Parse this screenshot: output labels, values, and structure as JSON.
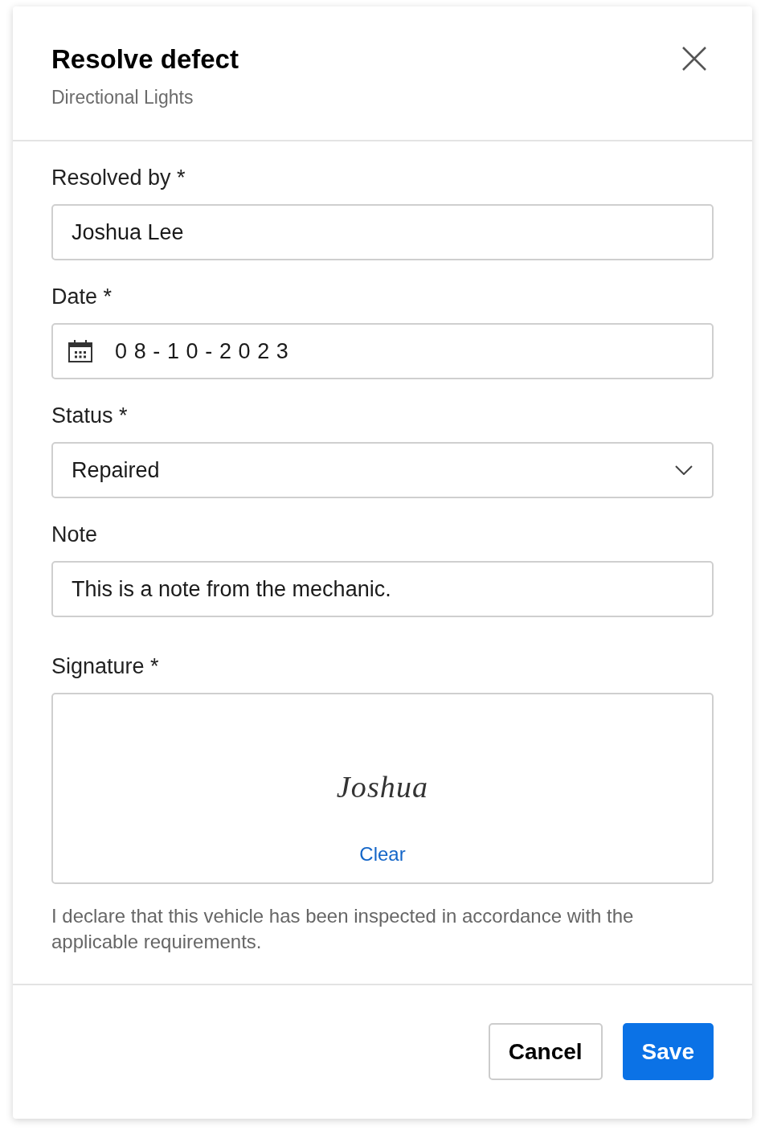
{
  "dialog": {
    "title": "Resolve defect",
    "subtitle": "Directional Lights"
  },
  "fields": [
    {
      "kind": "text",
      "label": "Resolved by *",
      "value": "Joshua Lee"
    },
    {
      "kind": "date",
      "label": "Date *",
      "value": "08-10-2023"
    },
    {
      "kind": "select",
      "label": "Status *",
      "value": "Repaired"
    },
    {
      "kind": "text",
      "label": "Note",
      "value": "This is a note from the mechanic."
    },
    {
      "kind": "signature",
      "label": "Signature *",
      "signature": "Joshua",
      "clear": "Clear"
    }
  ],
  "declaration": "I declare that this vehicle has been inspected in accordance with the applicable requirements.",
  "buttons": [
    {
      "kind": "secondary",
      "label": "Cancel"
    },
    {
      "kind": "primary",
      "label": "Save"
    }
  ]
}
